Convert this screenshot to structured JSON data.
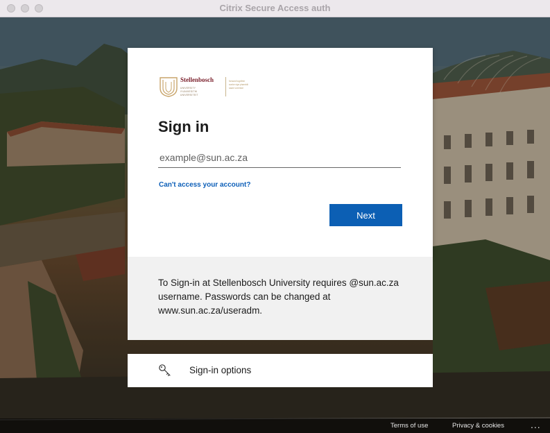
{
  "window": {
    "title": "Citrix Secure Access auth"
  },
  "logo": {
    "name": "Stellenbosch",
    "sub_lines": [
      "UNIVERSITY",
      "IYUNIVESITHI",
      "UNIVERSITEIT"
    ],
    "tagline_lines": [
      "forward together",
      "sonke siya phambili",
      "saam vorentoe"
    ]
  },
  "signin": {
    "title": "Sign in",
    "email_placeholder": "example@sun.ac.za",
    "email_value": "",
    "cant_access_link": "Can't access your account?",
    "next_label": "Next"
  },
  "info": {
    "text": "To Sign-in at Stellenbosch University requires @sun.ac.za username. Passwords can be changed at www.sun.ac.za/useradm."
  },
  "signin_options": {
    "label": "Sign-in options",
    "icon": "key-icon"
  },
  "footer": {
    "terms": "Terms of use",
    "privacy": "Privacy & cookies",
    "more": "..."
  },
  "colors": {
    "primary": "#0c5fb4",
    "link": "#0d5fb8",
    "brand_maroon": "#7a1f2b",
    "brand_gold": "#b59a6a"
  }
}
